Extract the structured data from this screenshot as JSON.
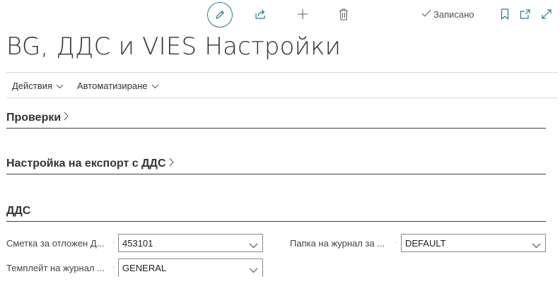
{
  "toolbar": {
    "saved_label": "Записано",
    "icons": [
      "pencil-icon",
      "share-icon",
      "plus-icon",
      "trash-icon",
      "check-icon",
      "bookmark-icon",
      "popout-icon",
      "expand-icon"
    ],
    "accent_color": "#2b7a8e"
  },
  "page": {
    "title": "BG, ДДС и VIES Настройки"
  },
  "actionbar": {
    "actions_label": "Действия",
    "automation_label": "Автоматизиране"
  },
  "sections": {
    "checks": "Проверки",
    "export": "Настройка на експорт с ДДС",
    "vat": "ДДС"
  },
  "fields": {
    "deferred_account": {
      "label": "Сметка за отложен Д...",
      "value": "453101"
    },
    "journal_batch": {
      "label": "Папка на журнал  за ...",
      "value": "DEFAULT"
    },
    "journal_template": {
      "label": "Темплейт на журнал ...",
      "value": "GENERAL"
    }
  }
}
